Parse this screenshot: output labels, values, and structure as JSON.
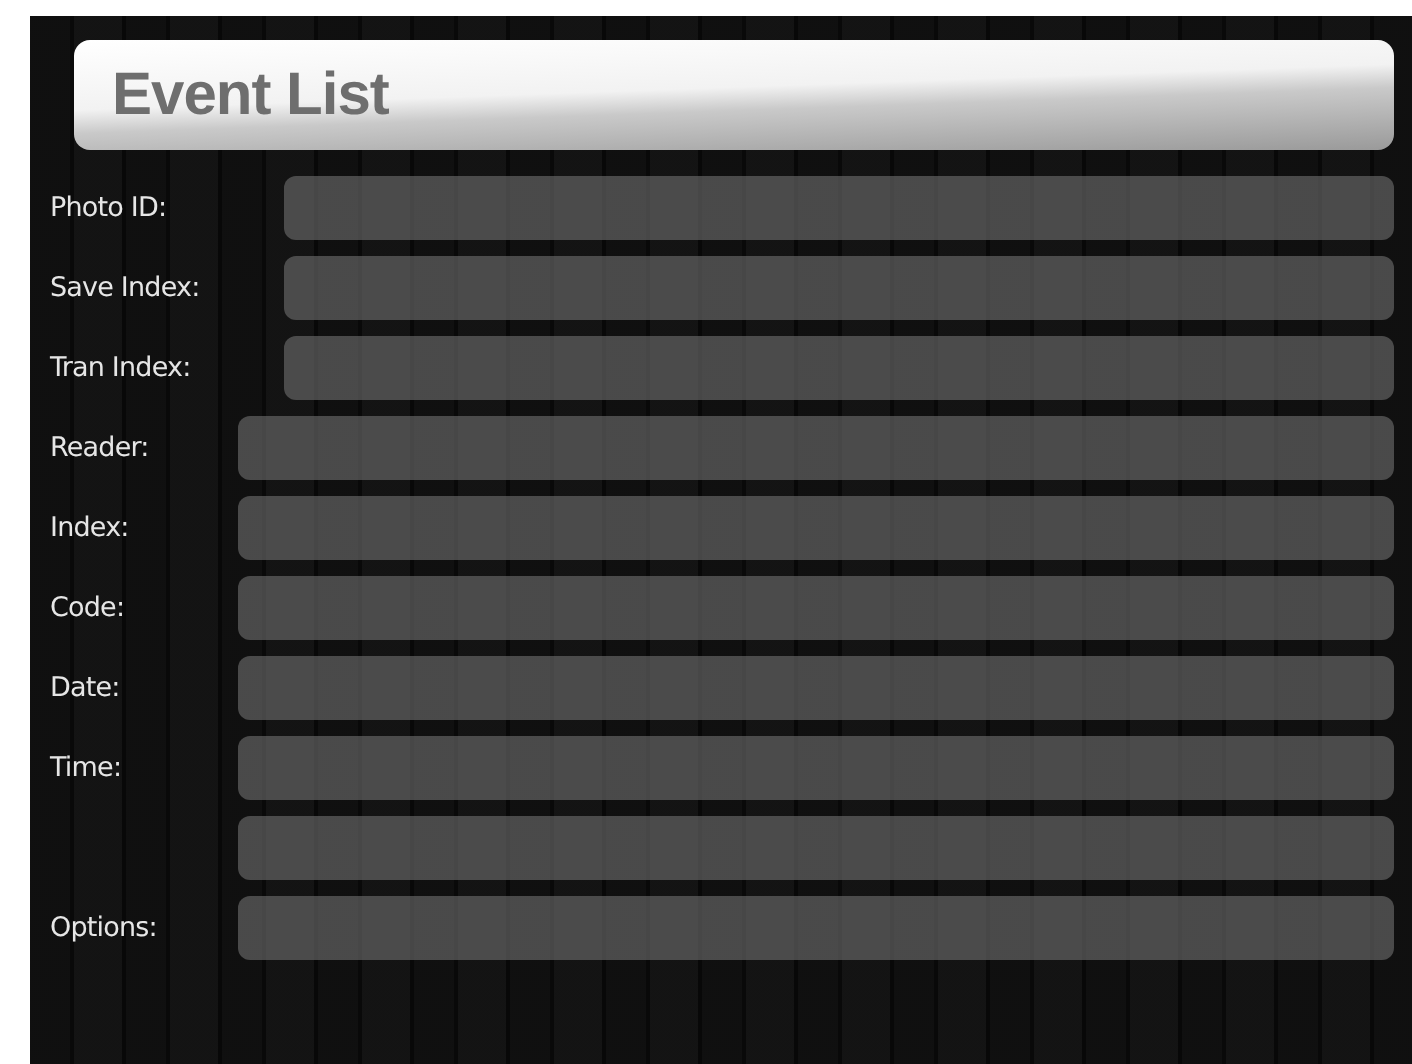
{
  "header": {
    "title": "Event List"
  },
  "id_fields": [
    {
      "kind": "labeled",
      "label": "Photo ID:"
    },
    {
      "kind": "labeled",
      "label": "Save Index:"
    },
    {
      "kind": "labeled",
      "label": "Tran Index:"
    }
  ],
  "event_fields": [
    {
      "kind": "labeled",
      "label": "Reader:"
    },
    {
      "kind": "labeled",
      "label": "Index:"
    },
    {
      "kind": "labeled",
      "label": "Code:"
    },
    {
      "kind": "labeled",
      "label": "Date:"
    },
    {
      "kind": "labeled",
      "label": "Time:"
    },
    {
      "kind": "unlabeled"
    },
    {
      "kind": "labeled",
      "label": "Options:"
    }
  ]
}
